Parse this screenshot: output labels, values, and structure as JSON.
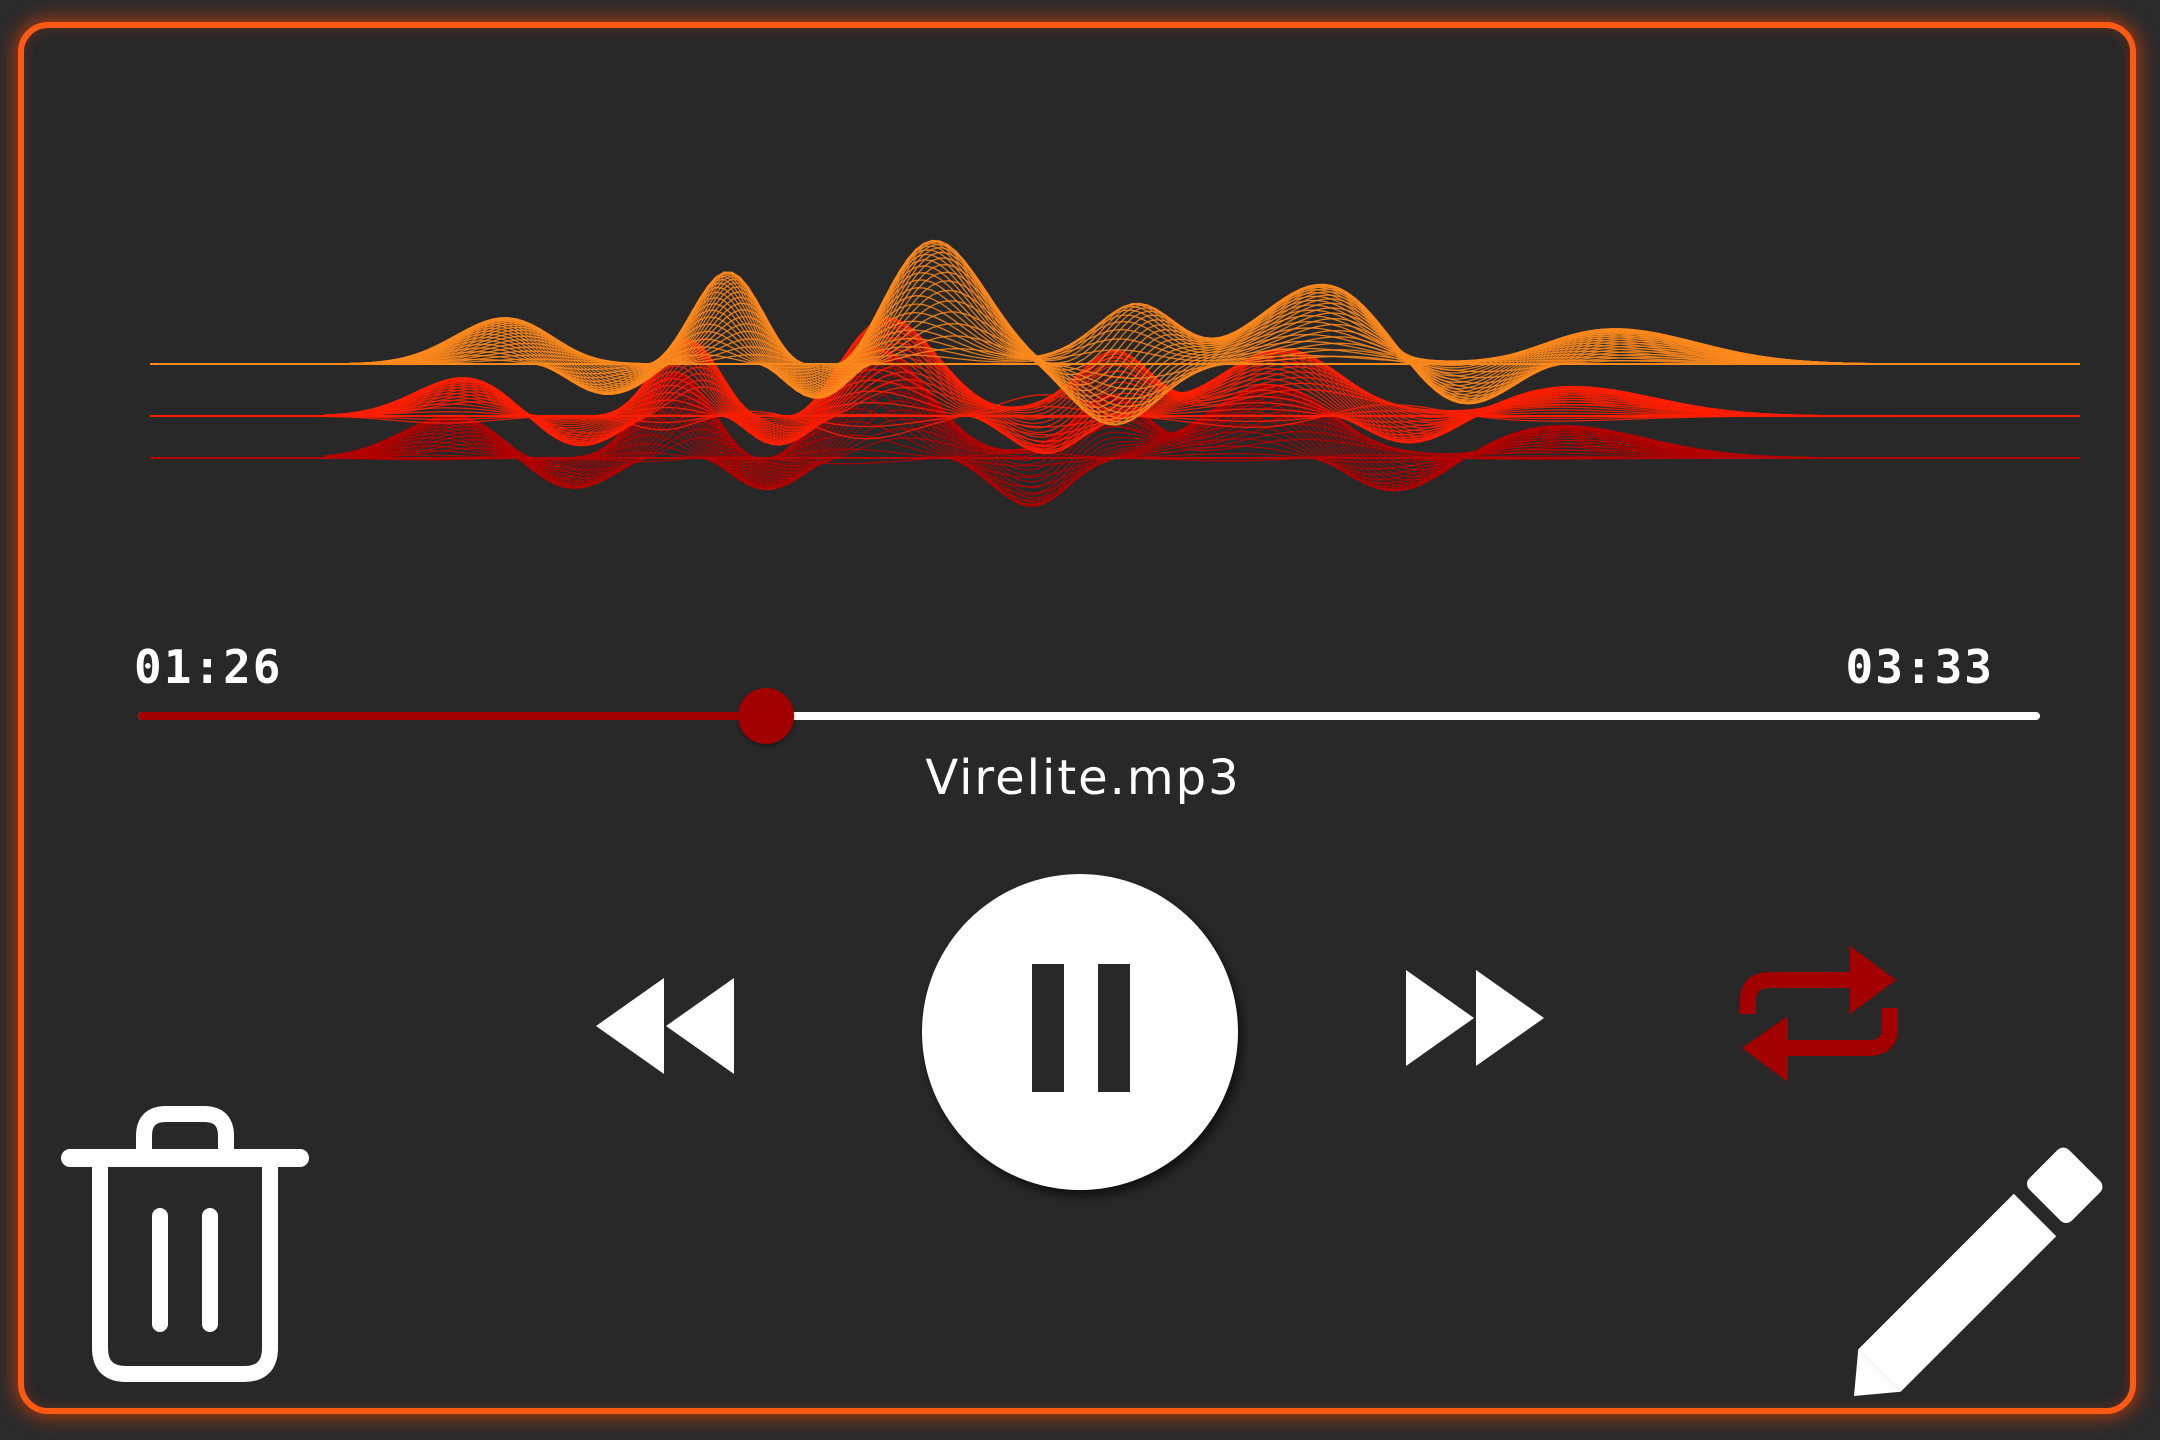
{
  "player": {
    "current_time": "01:26",
    "total_time": "03:33",
    "progress": 0.33,
    "track_name": "Virelite.mp3",
    "state": "playing"
  },
  "controls": {
    "rewind_icon": "rewind-icon",
    "pause_icon": "pause-icon",
    "forward_icon": "fast-forward-icon",
    "repeat_icon": "repeat-icon",
    "delete_icon": "trash-icon",
    "edit_icon": "pencil-icon"
  },
  "colors": {
    "frame_border": "#ff5a14",
    "background": "#282828",
    "accent_dark_red": "#a30000",
    "wave_orange": "#ff8a1c",
    "wave_red": "#ff1e00",
    "wave_dark_red": "#b40000",
    "foreground": "#ffffff"
  }
}
